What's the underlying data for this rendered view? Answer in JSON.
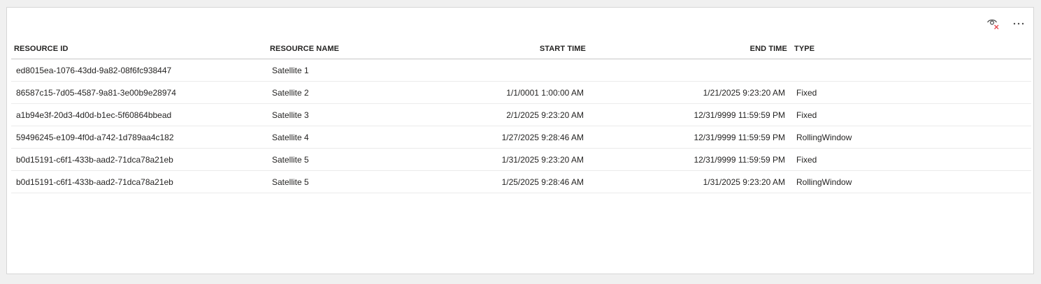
{
  "toolbar": {
    "visual_icon": "eye-hidden-icon",
    "more_icon": "more-options-icon",
    "more_label": "⋯"
  },
  "table": {
    "columns": {
      "resource_id": "RESOURCE ID",
      "resource_name": "RESOURCE NAME",
      "start_time": "START TIME",
      "end_time": "END TIME",
      "type": "TYPE"
    },
    "rows": [
      {
        "resource_id": "ed8015ea-1076-43dd-9a82-08f6fc938447",
        "resource_name": "Satellite 1",
        "start_time": "",
        "end_time": "",
        "type": ""
      },
      {
        "resource_id": "86587c15-7d05-4587-9a81-3e00b9e28974",
        "resource_name": "Satellite 2",
        "start_time": "1/1/0001 1:00:00 AM",
        "end_time": "1/21/2025 9:23:20 AM",
        "type": "Fixed"
      },
      {
        "resource_id": "a1b94e3f-20d3-4d0d-b1ec-5f60864bbead",
        "resource_name": "Satellite 3",
        "start_time": "2/1/2025 9:23:20 AM",
        "end_time": "12/31/9999 11:59:59 PM",
        "type": "Fixed"
      },
      {
        "resource_id": "59496245-e109-4f0d-a742-1d789aa4c182",
        "resource_name": "Satellite 4",
        "start_time": "1/27/2025 9:28:46 AM",
        "end_time": "12/31/9999 11:59:59 PM",
        "type": "RollingWindow"
      },
      {
        "resource_id": "b0d15191-c6f1-433b-aad2-71dca78a21eb",
        "resource_name": "Satellite 5",
        "start_time": "1/31/2025 9:23:20 AM",
        "end_time": "12/31/9999 11:59:59 PM",
        "type": "Fixed"
      },
      {
        "resource_id": "b0d15191-c6f1-433b-aad2-71dca78a21eb",
        "resource_name": "Satellite 5",
        "start_time": "1/25/2025 9:28:46 AM",
        "end_time": "1/31/2025 9:23:20 AM",
        "type": "RollingWindow"
      }
    ]
  },
  "colors": {
    "background": "#f0f0f0",
    "card": "#ffffff",
    "text": "#252423",
    "icon_accent": "#e8474c"
  }
}
